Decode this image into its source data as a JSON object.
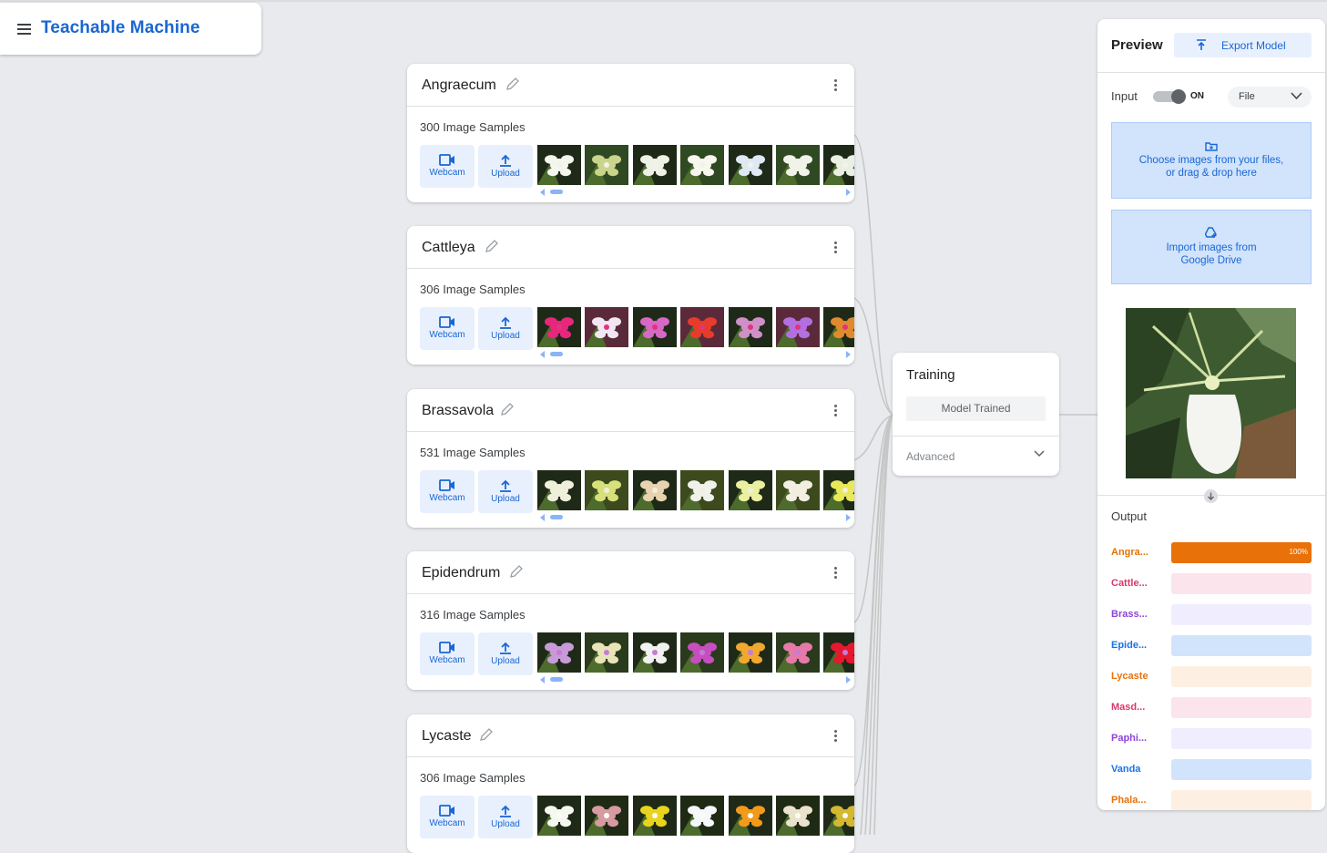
{
  "app": {
    "title": "Teachable Machine"
  },
  "classes": [
    {
      "name": "Angraecum",
      "samples": "300 Image Samples"
    },
    {
      "name": "Cattleya",
      "samples": "306 Image Samples"
    },
    {
      "name": "Brassavola",
      "samples": "531 Image Samples"
    },
    {
      "name": "Epidendrum",
      "samples": "316 Image Samples"
    },
    {
      "name": "Lycaste",
      "samples": "306 Image Samples"
    }
  ],
  "sample_buttons": {
    "webcam": "Webcam",
    "upload": "Upload"
  },
  "training": {
    "title": "Training",
    "button": "Model Trained",
    "advanced": "Advanced"
  },
  "preview": {
    "title": "Preview",
    "export": "Export Model",
    "input_label": "Input",
    "toggle": "ON",
    "source": "File",
    "choose_line1": "Choose images from your files,",
    "choose_line2": "or drag & drop here",
    "drive_line1": "Import images from",
    "drive_line2": "Google Drive",
    "output_title": "Output"
  },
  "outputs": [
    {
      "label": "Angra...",
      "color": "#e37400",
      "bg": "#e8710a",
      "value": 1.0,
      "pct": "100%"
    },
    {
      "label": "Cattle...",
      "color": "#d93a6a",
      "bg": "#fce4ec",
      "value": 0,
      "pct": ""
    },
    {
      "label": "Brass...",
      "color": "#8e44d9",
      "bg": "#f0eefe",
      "value": 0,
      "pct": ""
    },
    {
      "label": "Epide...",
      "color": "#1a73e8",
      "bg": "#d2e3fc",
      "value": 0,
      "pct": ""
    },
    {
      "label": "Lycaste",
      "color": "#e8710a",
      "bg": "#feefe3",
      "value": 0,
      "pct": ""
    },
    {
      "label": "Masd...",
      "color": "#d93a6a",
      "bg": "#fce4ec",
      "value": 0,
      "pct": ""
    },
    {
      "label": "Paphi...",
      "color": "#8e44d9",
      "bg": "#f0eefe",
      "value": 0,
      "pct": ""
    },
    {
      "label": "Vanda",
      "color": "#1a73e8",
      "bg": "#d2e3fc",
      "value": 0,
      "pct": ""
    },
    {
      "label": "Phala...",
      "color": "#e8710a",
      "bg": "#feefe3",
      "value": 0,
      "pct": ""
    }
  ],
  "thumb_palettes": [
    [
      "#2f4a22",
      "#f2f2ea"
    ],
    [
      "#5b2a3a",
      "#e0357d"
    ],
    [
      "#3d4a1e",
      "#eef0d8"
    ],
    [
      "#2a3a1c",
      "#c77bd6"
    ],
    [
      "#1f2a14",
      "#fbfbf5"
    ]
  ],
  "thumb_accents": [
    [
      "#f4f6ee",
      "#c9d58a",
      "#eef1e6",
      "#f7f7f0",
      "#dfe9f5",
      "#f1f2e8",
      "#e9efe2"
    ],
    [
      "#e7267d",
      "#f3e6f4",
      "#d768c6",
      "#e73c2c",
      "#cf90c9",
      "#b36fe0",
      "#e08a2e"
    ],
    [
      "#eef0dc",
      "#d8e07c",
      "#e8d2b0",
      "#f1f1ec",
      "#eaf0a0",
      "#f2eee2",
      "#e8e85a"
    ],
    [
      "#c89ad8",
      "#e9e4b8",
      "#f1f1f1",
      "#c54fbf",
      "#f0a830",
      "#e57aa8",
      "#e6182f"
    ],
    [
      "#f7f7f1",
      "#d79aa0",
      "#e8d41c",
      "#f5f7fb",
      "#f49a1a",
      "#e9e2cc",
      "#d3b830"
    ]
  ]
}
